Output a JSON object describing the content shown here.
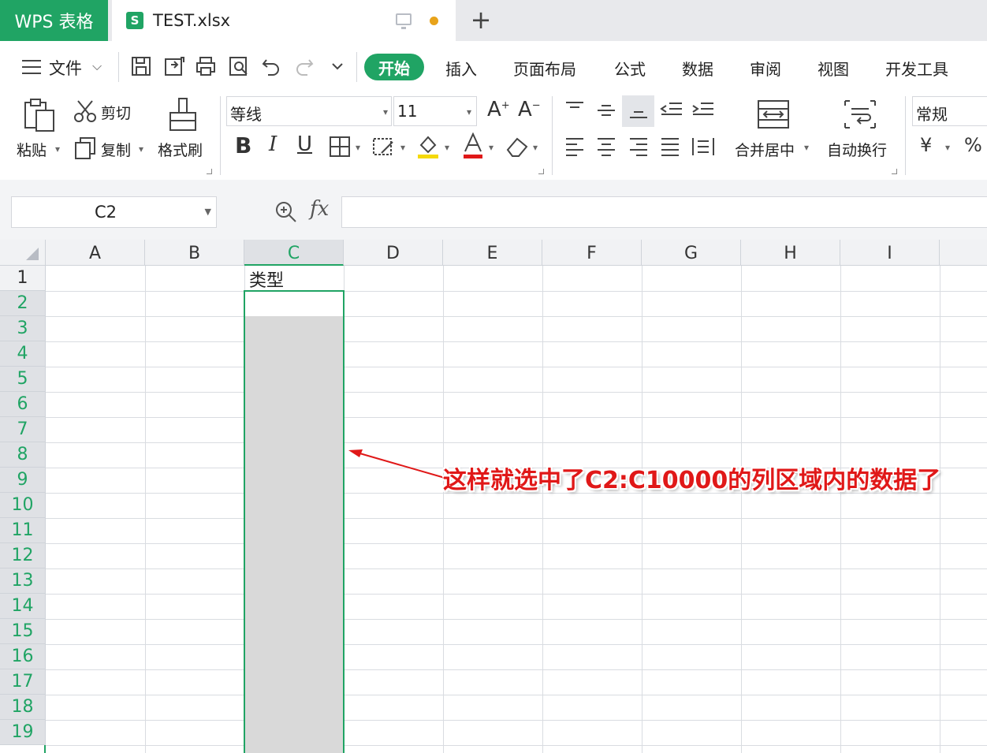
{
  "titlebar": {
    "app_label": "WPS 表格",
    "doc_icon_letter": "S",
    "doc_name": "TEST.xlsx",
    "unsaved_dot_color": "#e8a31a",
    "new_tab": "+"
  },
  "menu": {
    "file_label": "文件",
    "tabs": [
      "开始",
      "插入",
      "页面布局",
      "公式",
      "数据",
      "审阅",
      "视图",
      "开发工具"
    ],
    "active_tab": "开始",
    "accent_color": "#20a464"
  },
  "quick_access": [
    "save-icon",
    "export-icon",
    "print-icon",
    "print-preview-icon",
    "undo-icon",
    "redo-icon",
    "more-icon"
  ],
  "ribbon": {
    "paste_label": "粘贴",
    "cut_label": "剪切",
    "copy_label": "复制",
    "format_painter_label": "格式刷",
    "font_name": "等线",
    "font_size": "11",
    "bold": "B",
    "italic": "I",
    "underline": "U",
    "merge_center_label": "合并居中",
    "wrap_text_label": "自动换行",
    "number_format": "常规",
    "currency_symbol": "¥",
    "percent_symbol": "%"
  },
  "formula_bar": {
    "name_box": "C2",
    "fx_label": "fx",
    "formula": ""
  },
  "sheet": {
    "columns": [
      "A",
      "B",
      "C",
      "D",
      "E",
      "F",
      "G",
      "H",
      "I"
    ],
    "rows": [
      "1",
      "2",
      "3",
      "4",
      "5",
      "6",
      "7",
      "8",
      "9",
      "10",
      "11",
      "12",
      "13",
      "14",
      "15",
      "16",
      "17",
      "18",
      "19"
    ],
    "selected_column": "C",
    "cell_C1": "类型"
  },
  "annotation": "这样就选中了C2:C10000的列区域内的数据了"
}
